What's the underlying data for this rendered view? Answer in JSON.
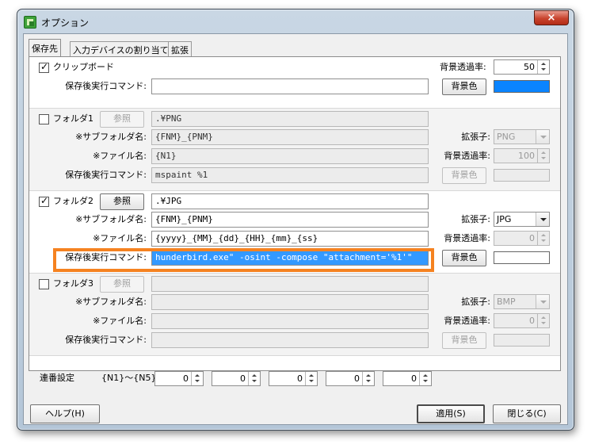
{
  "window": {
    "title": "オプション",
    "close_glyph": "×"
  },
  "tabs": [
    {
      "label": "保存先"
    },
    {
      "label": "入力デバイスの割り当て"
    },
    {
      "label": "拡張"
    }
  ],
  "clipboard": {
    "checkbox_label": "クリップボード",
    "checked": true,
    "command_label": "保存後実行コマンド:",
    "command_value": "",
    "opacity_label": "背景透過率:",
    "opacity_value": "50",
    "bgcolor_label": "背景色",
    "bgcolor": "#0a84ff"
  },
  "folders": [
    {
      "checkbox_label": "フォルダ1",
      "checked": false,
      "browse_label": "参照",
      "path": ".¥PNG",
      "subfolder_label": "※サブフォルダ名:",
      "subfolder": "{FNM}_{PNM}",
      "filename_label": "※ファイル名:",
      "filename": "{N1}",
      "command_label": "保存後実行コマンド:",
      "command": "mspaint %1",
      "ext_label": "拡張子:",
      "ext": "PNG",
      "opacity_label": "背景透過率:",
      "opacity": "100",
      "bgcolor_label": "背景色",
      "bgcolor": "#ececec"
    },
    {
      "checkbox_label": "フォルダ2",
      "checked": true,
      "browse_label": "参照",
      "path": ".¥JPG",
      "subfolder_label": "※サブフォルダ名:",
      "subfolder": "{FNM}_{PNM}",
      "filename_label": "※ファイル名:",
      "filename": "{yyyy}_{MM}_{dd}_{HH}_{mm}_{ss}",
      "command_label": "保存後実行コマンド:",
      "command": "hunderbird.exe\" -osint -compose \"attachment='%1'\"",
      "ext_label": "拡張子:",
      "ext": "JPG",
      "opacity_label": "背景透過率:",
      "opacity": "0",
      "bgcolor_label": "背景色",
      "bgcolor": "#ffffff"
    },
    {
      "checkbox_label": "フォルダ3",
      "checked": false,
      "browse_label": "参照",
      "path": "",
      "subfolder_label": "※サブフォルダ名:",
      "subfolder": "",
      "filename_label": "※ファイル名:",
      "filename": "",
      "command_label": "保存後実行コマンド:",
      "command": "",
      "ext_label": "拡張子:",
      "ext": "BMP",
      "opacity_label": "背景透過率:",
      "opacity": "0",
      "bgcolor_label": "背景色",
      "bgcolor": "#ececec"
    }
  ],
  "sequence": {
    "label": "連番設定",
    "range_label": "{N1}〜{N5}:",
    "values": [
      "0",
      "0",
      "0",
      "0",
      "0"
    ]
  },
  "footer": {
    "help_label": "ヘルプ(H)",
    "apply_label": "適用(S)",
    "close_label": "閉じる(C)"
  },
  "colors": {
    "highlight": "#f58220",
    "selection": "#3399ff"
  }
}
